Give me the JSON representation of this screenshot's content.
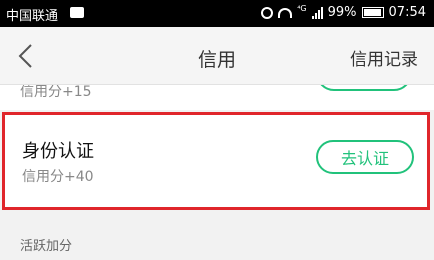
{
  "status_bar": {
    "carrier": "中国联通",
    "signal_text": "⁴G",
    "battery": "99%",
    "time": "07:54"
  },
  "nav": {
    "title": "信用",
    "records_label": "信用记录"
  },
  "partial_item": {
    "sub_label": "信用分+15"
  },
  "items": [
    {
      "title": "身份认证",
      "sub_label": "信用分+40",
      "button_label": "去认证"
    }
  ],
  "section": {
    "label": "活跃加分"
  },
  "colors": {
    "accent": "#21c27b",
    "highlight_border": "#e0262b",
    "status_bar": "#000000"
  }
}
